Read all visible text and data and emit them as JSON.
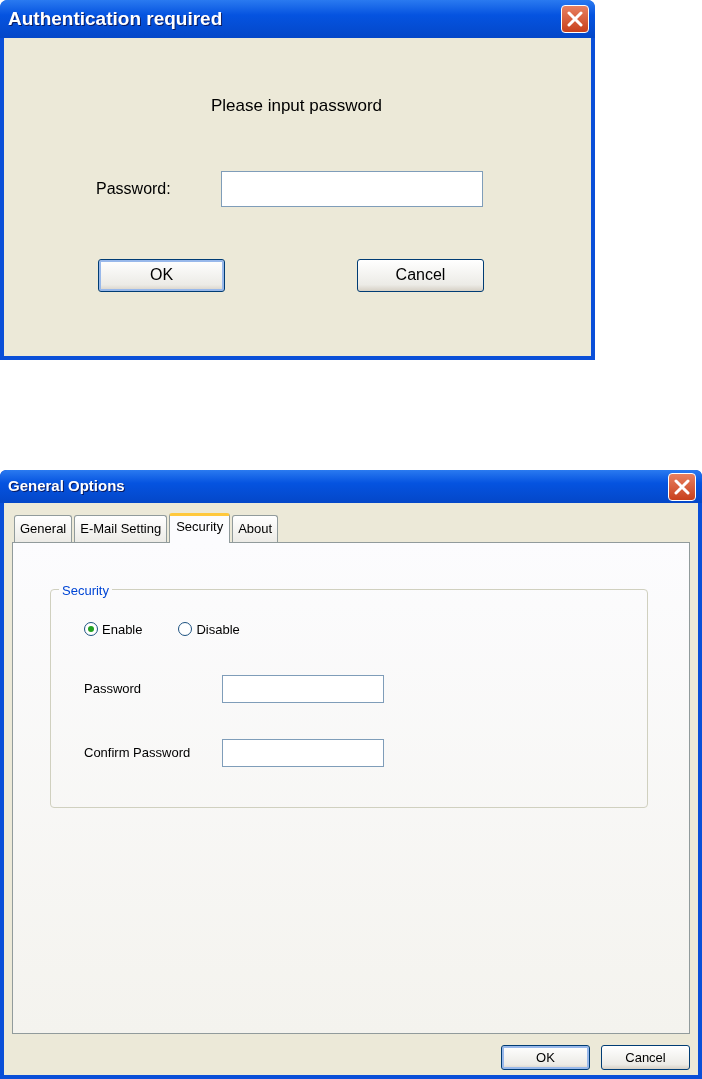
{
  "auth_dialog": {
    "title": "Authentication required",
    "message": "Please input password",
    "fields": [
      {
        "label": "Password:"
      }
    ],
    "buttons": [
      {
        "label": "OK",
        "default": true
      },
      {
        "label": "Cancel",
        "default": false
      }
    ]
  },
  "options_dialog": {
    "title": "General Options",
    "tabs": [
      {
        "label": "General",
        "selected": false
      },
      {
        "label": "E-Mail Setting",
        "selected": false
      },
      {
        "label": "Security",
        "selected": true
      },
      {
        "label": "About",
        "selected": false
      }
    ],
    "group": {
      "title": "Security",
      "radios": [
        {
          "label": "Enable",
          "selected": true
        },
        {
          "label": "Disable",
          "selected": false
        }
      ],
      "fields": [
        {
          "label": "Password"
        },
        {
          "label": "Confirm Password"
        }
      ]
    },
    "buttons": [
      {
        "label": "OK",
        "default": true
      },
      {
        "label": "Cancel",
        "default": false
      }
    ]
  }
}
